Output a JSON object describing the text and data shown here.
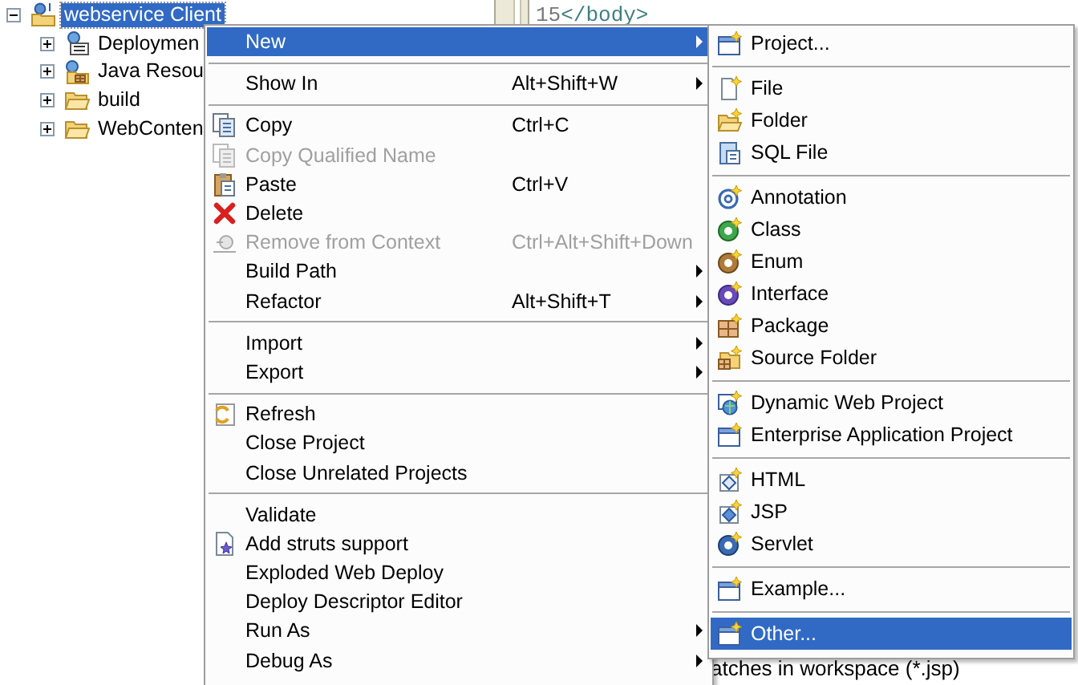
{
  "tree": {
    "items": [
      {
        "label": "webservice Client",
        "selected": true,
        "expanded": true,
        "children": [
          {
            "label": "Deploymen",
            "selected": false,
            "expanded": false
          },
          {
            "label": "Java Resou",
            "selected": false,
            "expanded": false
          },
          {
            "label": "build",
            "selected": false,
            "expanded": false
          },
          {
            "label": "WebConten",
            "selected": false,
            "expanded": false
          }
        ]
      }
    ]
  },
  "editor": {
    "line_number": "15",
    "code": "</body>",
    "search_result": "atches in workspace (*.jsp)"
  },
  "context_menu": {
    "items": [
      {
        "kind": "item",
        "label": "New",
        "selected": true,
        "disabled": false,
        "submenu": true
      },
      {
        "kind": "separator"
      },
      {
        "kind": "item",
        "label": "Show In",
        "shortcut": "Alt+Shift+W",
        "selected": false,
        "disabled": false,
        "submenu": true
      },
      {
        "kind": "separator"
      },
      {
        "kind": "item",
        "label": "Copy",
        "shortcut": "Ctrl+C",
        "selected": false,
        "disabled": false,
        "submenu": false
      },
      {
        "kind": "item",
        "label": "Copy Qualified Name",
        "selected": false,
        "disabled": true,
        "submenu": false
      },
      {
        "kind": "item",
        "label": "Paste",
        "shortcut": "Ctrl+V",
        "selected": false,
        "disabled": false,
        "submenu": false
      },
      {
        "kind": "item",
        "label": "Delete",
        "selected": false,
        "disabled": false,
        "submenu": false
      },
      {
        "kind": "item",
        "label": "Remove from Context",
        "shortcut": "Ctrl+Alt+Shift+Down",
        "selected": false,
        "disabled": true,
        "submenu": false
      },
      {
        "kind": "item",
        "label": "Build Path",
        "selected": false,
        "disabled": false,
        "submenu": true
      },
      {
        "kind": "item",
        "label": "Refactor",
        "shortcut": "Alt+Shift+T",
        "selected": false,
        "disabled": false,
        "submenu": true
      },
      {
        "kind": "separator"
      },
      {
        "kind": "item",
        "label": "Import",
        "selected": false,
        "disabled": false,
        "submenu": true
      },
      {
        "kind": "item",
        "label": "Export",
        "selected": false,
        "disabled": false,
        "submenu": true
      },
      {
        "kind": "separator"
      },
      {
        "kind": "item",
        "label": "Refresh",
        "selected": false,
        "disabled": false,
        "submenu": false
      },
      {
        "kind": "item",
        "label": "Close Project",
        "selected": false,
        "disabled": false,
        "submenu": false
      },
      {
        "kind": "item",
        "label": "Close Unrelated Projects",
        "selected": false,
        "disabled": false,
        "submenu": false
      },
      {
        "kind": "separator"
      },
      {
        "kind": "item",
        "label": "Validate",
        "selected": false,
        "disabled": false,
        "submenu": false
      },
      {
        "kind": "item",
        "label": "Add struts support",
        "selected": false,
        "disabled": false,
        "submenu": false
      },
      {
        "kind": "item",
        "label": "Exploded Web Deploy",
        "selected": false,
        "disabled": false,
        "submenu": false
      },
      {
        "kind": "item",
        "label": "Deploy Descriptor Editor",
        "selected": false,
        "disabled": false,
        "submenu": false
      },
      {
        "kind": "item",
        "label": "Run As",
        "selected": false,
        "disabled": false,
        "submenu": true
      },
      {
        "kind": "item",
        "label": "Debug As",
        "selected": false,
        "disabled": false,
        "submenu": true
      }
    ]
  },
  "submenu": {
    "items": [
      {
        "kind": "item",
        "label": "Project...",
        "selected": false
      },
      {
        "kind": "separator"
      },
      {
        "kind": "item",
        "label": "File",
        "selected": false
      },
      {
        "kind": "item",
        "label": "Folder",
        "selected": false
      },
      {
        "kind": "item",
        "label": "SQL File",
        "selected": false
      },
      {
        "kind": "separator"
      },
      {
        "kind": "item",
        "label": "Annotation",
        "selected": false
      },
      {
        "kind": "item",
        "label": "Class",
        "selected": false
      },
      {
        "kind": "item",
        "label": "Enum",
        "selected": false
      },
      {
        "kind": "item",
        "label": "Interface",
        "selected": false
      },
      {
        "kind": "item",
        "label": "Package",
        "selected": false
      },
      {
        "kind": "item",
        "label": "Source Folder",
        "selected": false
      },
      {
        "kind": "separator"
      },
      {
        "kind": "item",
        "label": "Dynamic Web Project",
        "selected": false
      },
      {
        "kind": "item",
        "label": "Enterprise Application Project",
        "selected": false
      },
      {
        "kind": "separator"
      },
      {
        "kind": "item",
        "label": "HTML",
        "selected": false
      },
      {
        "kind": "item",
        "label": "JSP",
        "selected": false
      },
      {
        "kind": "item",
        "label": "Servlet",
        "selected": false
      },
      {
        "kind": "separator"
      },
      {
        "kind": "item",
        "label": "Example...",
        "selected": false
      },
      {
        "kind": "separator"
      },
      {
        "kind": "item",
        "label": "Other...",
        "selected": true
      }
    ]
  }
}
